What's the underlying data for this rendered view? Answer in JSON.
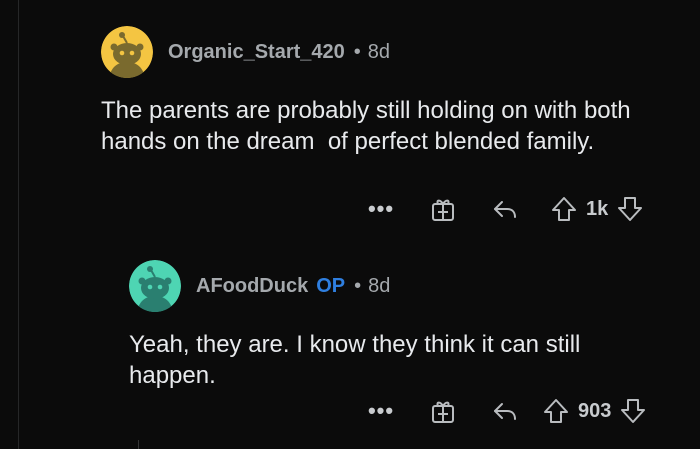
{
  "comments": [
    {
      "username": "Organic_Start_420",
      "separator": "•",
      "age": "8d",
      "body": "The parents are probably still holding on with both hands on the dream  of perfect blended family.",
      "score": "1k",
      "more_label": "•••",
      "avatar_color": "#f4c542"
    },
    {
      "username": "AFoodDuck",
      "badge": "OP",
      "separator": "•",
      "age": "8d",
      "body": "Yeah, they are. I know they think it can still happen.",
      "score": "903",
      "more_label": "•••",
      "avatar_color": "#4ed5b3"
    }
  ],
  "icons": [
    "snoo-avatar",
    "award-icon",
    "reply-icon",
    "upvote-icon",
    "downvote-icon"
  ]
}
